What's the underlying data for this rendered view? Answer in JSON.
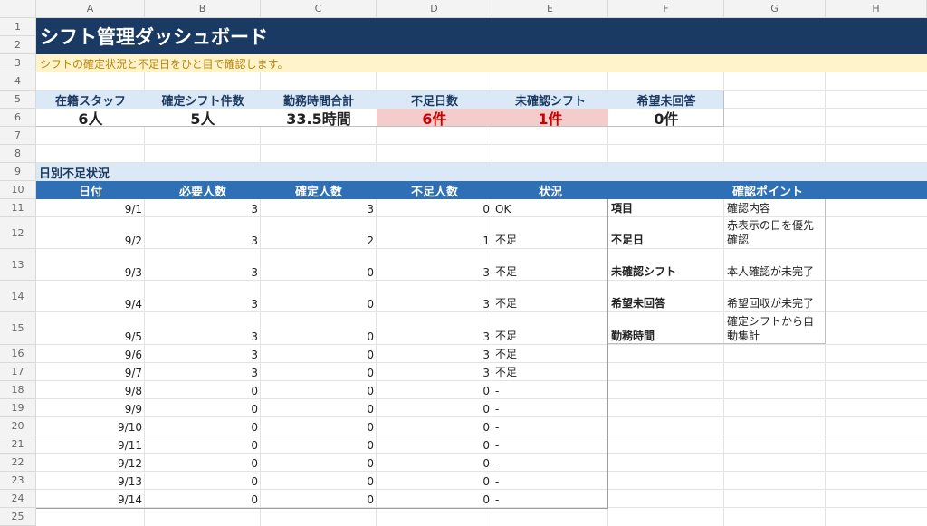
{
  "columns": [
    "A",
    "B",
    "C",
    "D",
    "E",
    "F",
    "G",
    "H"
  ],
  "rows": [
    "1",
    "2",
    "3",
    "4",
    "5",
    "6",
    "7",
    "8",
    "9",
    "10",
    "11",
    "12",
    "13",
    "14",
    "15",
    "16",
    "17",
    "18",
    "19",
    "20",
    "21",
    "22",
    "23",
    "24",
    "25"
  ],
  "title": "シフト管理ダッシュボード",
  "subtitle": "シフトの確定状況と不足日をひと目で確認します。",
  "colors": {
    "banner": "#1b3a63",
    "subtitle_bg": "#fff3cc",
    "subtitle_text": "#b8860b",
    "kpi_label_bg": "#dbe8f5",
    "warn_bg": "#f4cccc",
    "warn_text": "#cc0000",
    "table_header_bg": "#2e6fb5"
  },
  "kpis": [
    {
      "label": "在籍スタッフ",
      "value": "6人",
      "warn": false
    },
    {
      "label": "確定シフト件数",
      "value": "5人",
      "warn": false
    },
    {
      "label": "勤務時間合計",
      "value": "33.5時間",
      "warn": false
    },
    {
      "label": "不足日数",
      "value": "6件",
      "warn": true
    },
    {
      "label": "未確認シフト",
      "value": "1件",
      "warn": true
    },
    {
      "label": "希望未回答",
      "value": "0件",
      "warn": false
    }
  ],
  "section_title": "日別不足状況",
  "table": {
    "headers": [
      "日付",
      "必要人数",
      "確定人数",
      "不足人数",
      "状況"
    ],
    "rows": [
      [
        "9/1",
        "3",
        "3",
        "0",
        "OK"
      ],
      [
        "9/2",
        "3",
        "2",
        "1",
        "不足"
      ],
      [
        "9/3",
        "3",
        "0",
        "3",
        "不足"
      ],
      [
        "9/4",
        "3",
        "0",
        "3",
        "不足"
      ],
      [
        "9/5",
        "3",
        "0",
        "3",
        "不足"
      ],
      [
        "9/6",
        "3",
        "0",
        "3",
        "不足"
      ],
      [
        "9/7",
        "3",
        "0",
        "3",
        "不足"
      ],
      [
        "9/8",
        "0",
        "0",
        "0",
        "-"
      ],
      [
        "9/9",
        "0",
        "0",
        "0",
        "-"
      ],
      [
        "9/10",
        "0",
        "0",
        "0",
        "-"
      ],
      [
        "9/11",
        "0",
        "0",
        "0",
        "-"
      ],
      [
        "9/12",
        "0",
        "0",
        "0",
        "-"
      ],
      [
        "9/13",
        "0",
        "0",
        "0",
        "-"
      ],
      [
        "9/14",
        "0",
        "0",
        "0",
        "-"
      ]
    ]
  },
  "points": {
    "header": "確認ポイント",
    "col_item": "項目",
    "col_content": "確認内容",
    "items": [
      {
        "item": "不足日",
        "content": "赤表示の日を優先確認"
      },
      {
        "item": "未確認シフト",
        "content": "本人確認が未完了"
      },
      {
        "item": "希望未回答",
        "content": "希望回収が未完了"
      },
      {
        "item": "勤務時間",
        "content": "確定シフトから自動集計"
      }
    ]
  }
}
